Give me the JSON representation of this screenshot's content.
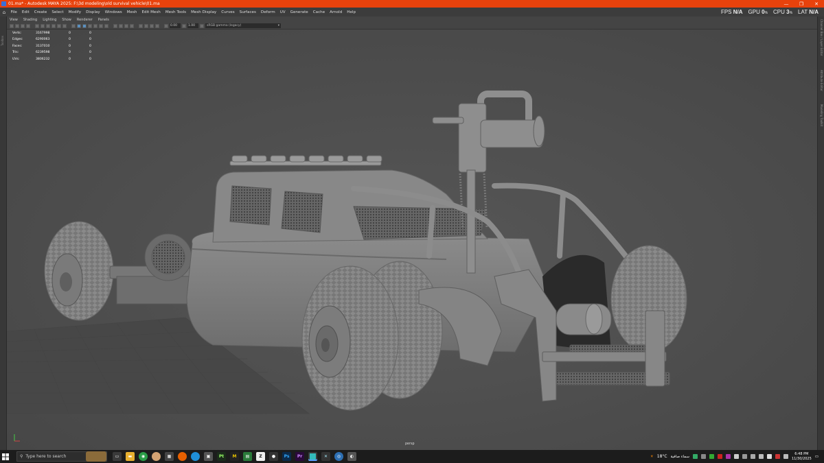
{
  "window": {
    "title": "01.ma* - Autodesk MAYA 2025: F:\\3d modeling\\old survival vehicle\\01.ma",
    "minimize": "—",
    "maximize": "❐",
    "close": "✕"
  },
  "menu": {
    "items": [
      "File",
      "Edit",
      "Create",
      "Select",
      "Modify",
      "Display",
      "Windows",
      "Mesh",
      "Edit Mesh",
      "Mesh Tools",
      "Mesh Display",
      "Curves",
      "Surfaces",
      "Deform",
      "UV",
      "Generate",
      "Cache",
      "Arnold",
      "Help"
    ]
  },
  "perf": {
    "fps_label": "FPS",
    "fps_value": "N/A",
    "gpu_label": "GPU",
    "gpu_value": "0",
    "gpu_unit": "%",
    "cpu_label": "CPU",
    "cpu_value": "3",
    "cpu_unit": "%",
    "lat_label": "LAT",
    "lat_value": "N/A"
  },
  "panel_menu": [
    "View",
    "Shading",
    "Lighting",
    "Show",
    "Renderer",
    "Panels"
  ],
  "panel_toolbar": {
    "value_a": "0.00",
    "value_b": "1.00",
    "color_space": "sRGB gamma (legacy)"
  },
  "hud": {
    "rows": [
      {
        "label": "Verts:",
        "v1": "3167998",
        "v2": "0",
        "v3": "0"
      },
      {
        "label": "Edges:",
        "v1": "6290063",
        "v2": "0",
        "v3": "0"
      },
      {
        "label": "Faces:",
        "v1": "3137010",
        "v2": "0",
        "v3": "0"
      },
      {
        "label": "Tris:",
        "v1": "6239598",
        "v2": "0",
        "v3": "0"
      },
      {
        "label": "UVs:",
        "v1": "3806232",
        "v2": "0",
        "v3": "0"
      }
    ]
  },
  "viewport": {
    "camera": "persp"
  },
  "side_tabs": {
    "left": "Toolbox",
    "right": [
      "Channel Box / Layer Editor",
      "Attribute Editor",
      "Modeling Toolkit"
    ]
  },
  "taskbar": {
    "search_placeholder": "Type here to search",
    "weather_temp": "18°C",
    "weather_text": "سماء صافية",
    "time": "6:48 PM",
    "date": "11/30/2025"
  },
  "colors": {
    "titlebar": "#e8420c",
    "viewport": "#4e4e4e",
    "taskbar": "#1c1c1c"
  }
}
